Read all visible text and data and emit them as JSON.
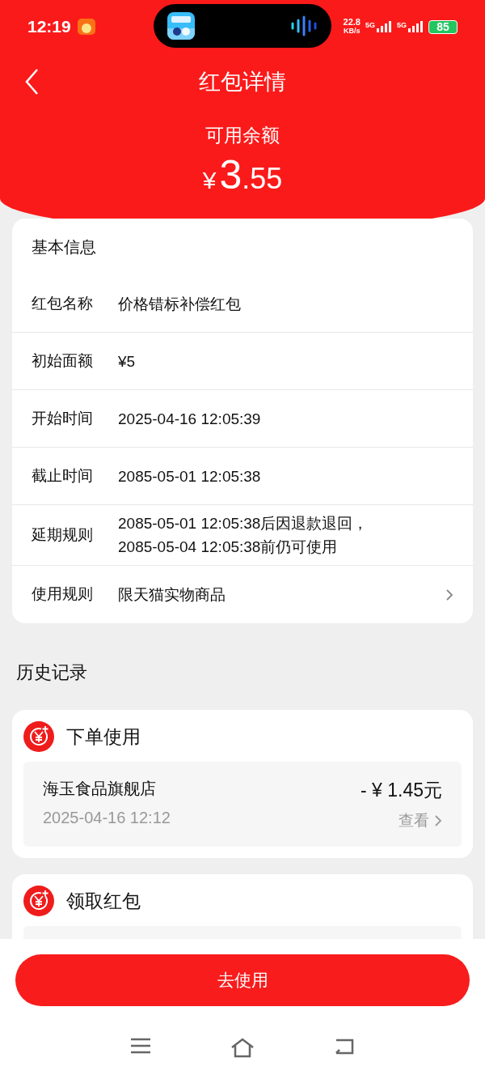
{
  "status_bar": {
    "time": "12:19",
    "speed": "22.8",
    "speed_unit": "KB/s",
    "networks": [
      "5G",
      "5G"
    ],
    "battery": "85"
  },
  "header": {
    "title": "红包详情",
    "balance_label": "可用余额",
    "currency": "¥",
    "amount_int": "3",
    "amount_dec": ".55"
  },
  "basic_info": {
    "title": "基本信息",
    "rows": [
      {
        "label": "红包名称",
        "value": "价格错标补偿红包",
        "link": false
      },
      {
        "label": "初始面额",
        "value": "¥5",
        "link": false
      },
      {
        "label": "开始时间",
        "value": "2025-04-16 12:05:39",
        "link": false
      },
      {
        "label": "截止时间",
        "value": "2085-05-01 12:05:38",
        "link": false
      },
      {
        "label": "延期规则",
        "value": "2085-05-01 12:05:38后因退款退回，\n2085-05-04 12:05:38前仍可使用",
        "link": false
      },
      {
        "label": "使用规则",
        "value": "限天猫实物商品",
        "link": true
      }
    ]
  },
  "history": {
    "title": "历史记录",
    "groups": [
      {
        "title": "下单使用",
        "entries": [
          {
            "shop": "海玉食品旗舰店",
            "time": "2025-04-16 12:12",
            "amount": "- ¥ 1.45元",
            "action": "查看"
          }
        ]
      },
      {
        "title": "领取红包"
      }
    ]
  },
  "action_button": "去使用"
}
